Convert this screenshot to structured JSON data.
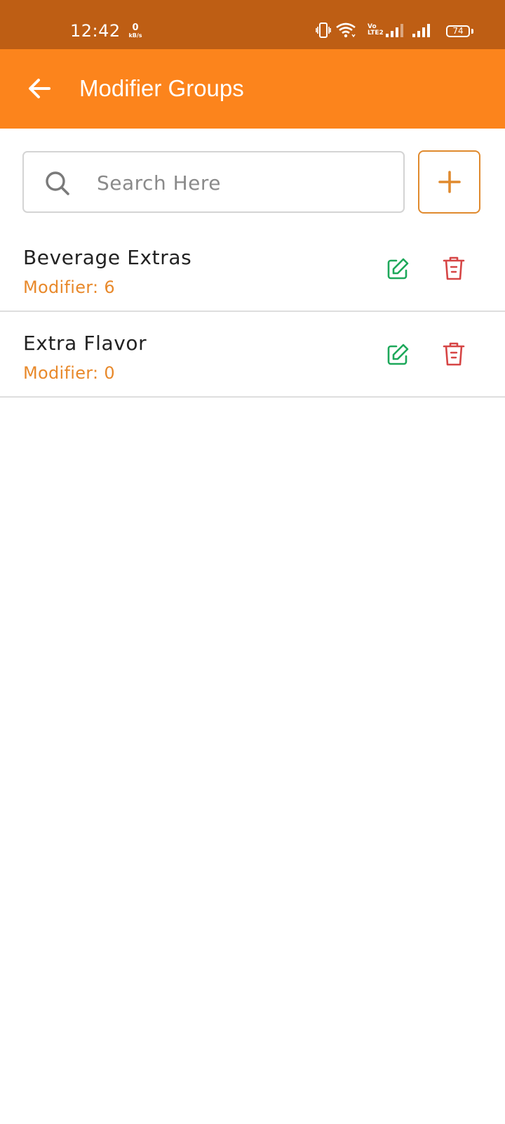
{
  "status_bar": {
    "time": "12:42",
    "net_speed_value": "0",
    "net_speed_unit": "kB/s",
    "volte_top": "Vo",
    "volte_bottom": "LTE2",
    "battery": "74"
  },
  "app_bar": {
    "title": "Modifier Groups",
    "background_color": "#FC841C",
    "back_icon": "arrow-left-icon"
  },
  "search": {
    "placeholder": "Search Here",
    "value": "",
    "icon": "search-icon"
  },
  "add_button": {
    "icon": "plus-icon",
    "color": "#E08A2E"
  },
  "groups": [
    {
      "name": "Beverage Extras",
      "modifier_count": "Modifier: 6"
    },
    {
      "name": "Extra Flavor",
      "modifier_count": "Modifier: 0"
    }
  ],
  "colors": {
    "status_bar": "#BE5E14",
    "accent": "#E8892B",
    "edit": "#1DA85A",
    "delete": "#D64545"
  }
}
